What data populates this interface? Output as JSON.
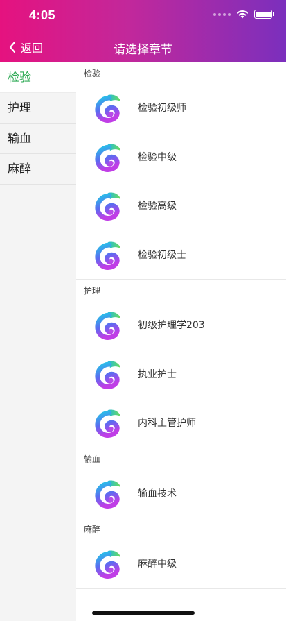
{
  "status_bar": {
    "time": "4:05"
  },
  "nav": {
    "back_label": "返回",
    "title": "请选择章节"
  },
  "sidebar": {
    "items": [
      {
        "label": "检验",
        "active": true
      },
      {
        "label": "护理",
        "active": false
      },
      {
        "label": "输血",
        "active": false
      },
      {
        "label": "麻醉",
        "active": false
      }
    ]
  },
  "sections": [
    {
      "title": "检验",
      "items": [
        "检验初级师",
        "检验中级",
        "检验高级",
        "检验初级士"
      ]
    },
    {
      "title": "护理",
      "items": [
        "初级护理学203",
        "执业护士",
        "内科主管护师"
      ]
    },
    {
      "title": "输血",
      "items": [
        "输血技术"
      ]
    },
    {
      "title": "麻醉",
      "items": [
        "麻醉中级"
      ]
    }
  ],
  "colors": {
    "header_gradient_start": "#e5127f",
    "header_gradient_end": "#7b2fbd",
    "active_green": "#2eaa55"
  },
  "icons": {
    "row_icon": "chameleon-logo-icon",
    "back": "chevron-left-icon"
  }
}
